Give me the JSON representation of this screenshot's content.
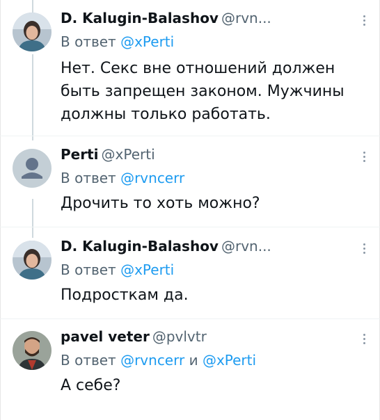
{
  "tweets": [
    {
      "name": "D. Kalugin-Balashov",
      "handle": "@rvn...",
      "reply_prefix": "В ответ",
      "reply_to_1": "@xPerti",
      "reply_joiner": "",
      "reply_to_2": "",
      "text": "Нет. Секс вне отношений должен быть запрещен законом. Мужчины должны только работать.",
      "avatar": "portrait-avatar"
    },
    {
      "name": "Perti",
      "handle": "@xPerti",
      "reply_prefix": "В ответ",
      "reply_to_1": "@rvncerr",
      "reply_joiner": "",
      "reply_to_2": "",
      "text": "Дрочить то хоть можно?",
      "avatar": "default-person-avatar"
    },
    {
      "name": "D. Kalugin-Balashov",
      "handle": "@rvn...",
      "reply_prefix": "В ответ",
      "reply_to_1": "@xPerti",
      "reply_joiner": "",
      "reply_to_2": "",
      "text": "Подросткам да.",
      "avatar": "portrait-avatar"
    },
    {
      "name": "pavel veter",
      "handle": "@pvlvtr",
      "reply_prefix": "В ответ",
      "reply_to_1": "@rvncerr",
      "reply_joiner": "и",
      "reply_to_2": "@xPerti",
      "text": "А себе?",
      "avatar": "bearded-man-avatar"
    }
  ],
  "colors": {
    "accent": "#1d9bf0",
    "secondary_text": "#536471",
    "primary_text": "#0f1419",
    "thread_line": "#cfd9de"
  }
}
